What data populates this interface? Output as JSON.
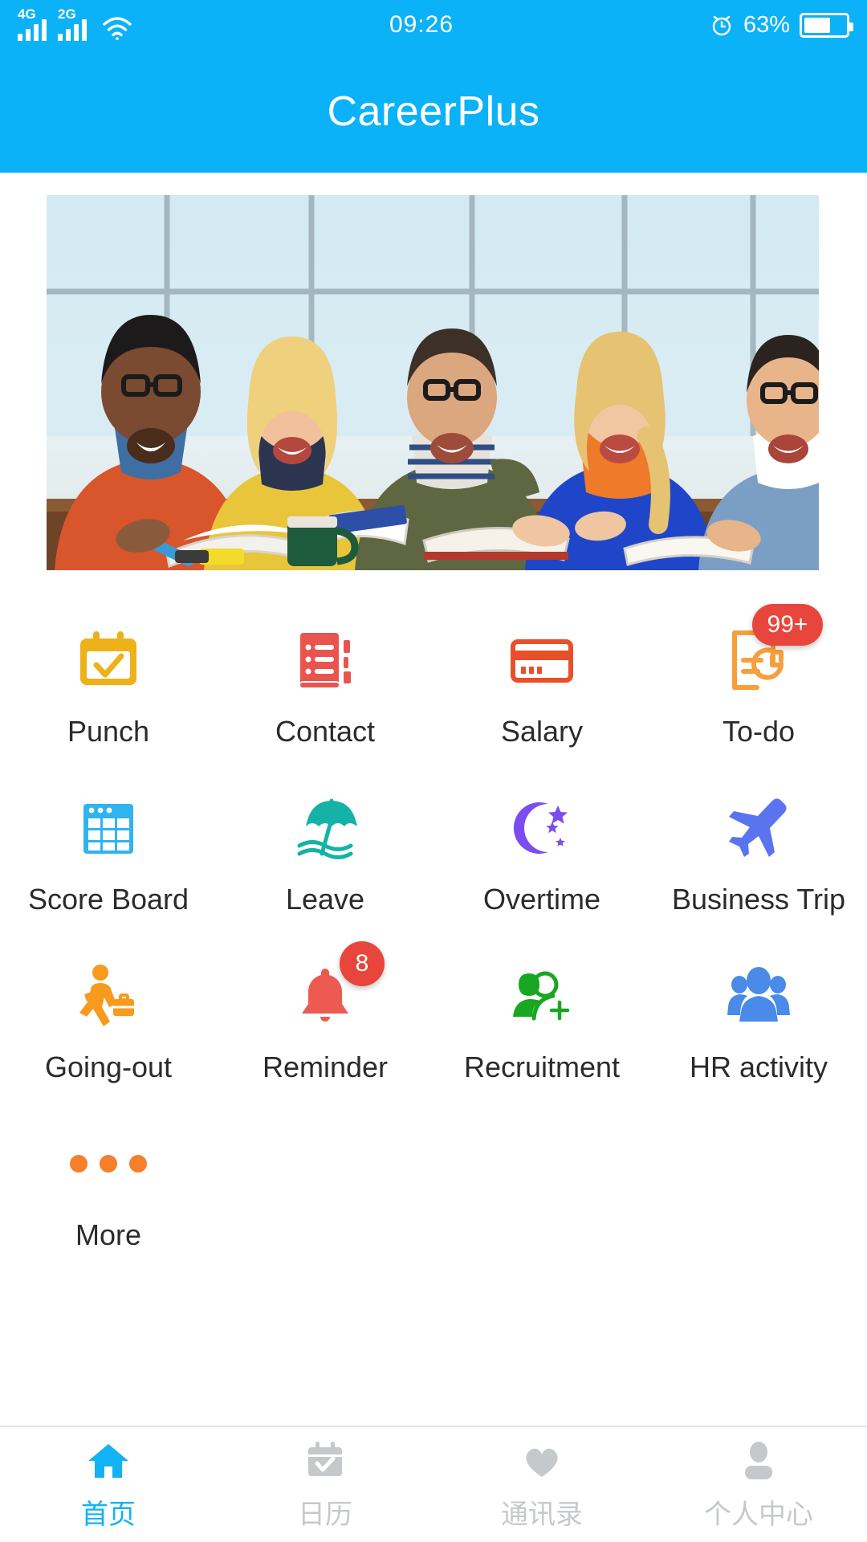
{
  "status_bar": {
    "network_primary": "4G",
    "network_secondary": "2G",
    "wifi_icon": "wifi-icon",
    "time": "09:26",
    "alarm_icon": "alarm-clock-icon",
    "battery_percent": "63%",
    "battery_level": 63
  },
  "header": {
    "title": "CareerPlus",
    "background_color": "#0bb2f7"
  },
  "banner": {
    "alt": "five smiling colleagues studying together at a table with books"
  },
  "grid": {
    "items": [
      {
        "label": "Punch",
        "icon": "calendar-check-icon",
        "color": "#edb11a",
        "badge": null
      },
      {
        "label": "Contact",
        "icon": "address-book-icon",
        "color": "#e9544f",
        "badge": null
      },
      {
        "label": "Salary",
        "icon": "credit-card-icon",
        "color": "#e8502a",
        "badge": null
      },
      {
        "label": "To-do",
        "icon": "document-clock-icon",
        "color": "#f5a03c",
        "badge": "99+"
      },
      {
        "label": "Score Board",
        "icon": "table-grid-icon",
        "color": "#2fb4f0",
        "badge": null
      },
      {
        "label": "Leave",
        "icon": "beach-umbrella-icon",
        "color": "#14b3a6",
        "badge": null
      },
      {
        "label": "Overtime",
        "icon": "moon-stars-icon",
        "color": "#7b4df0",
        "badge": null
      },
      {
        "label": "Business Trip",
        "icon": "airplane-icon",
        "color": "#5a74f0",
        "badge": null
      },
      {
        "label": "Going-out",
        "icon": "walking-briefcase-icon",
        "color": "#f79a1e",
        "badge": null
      },
      {
        "label": "Reminder",
        "icon": "bell-icon",
        "color": "#ec5a52",
        "badge": "8"
      },
      {
        "label": "Recruitment",
        "icon": "person-add-icon",
        "color": "#19a721",
        "badge": null
      },
      {
        "label": "HR activity",
        "icon": "people-group-icon",
        "color": "#4a8ae8",
        "badge": null
      },
      {
        "label": "More",
        "icon": "ellipsis-icon",
        "color": "#f57f2a",
        "badge": null
      }
    ],
    "badge_color": "#e8453c"
  },
  "tab_bar": {
    "active_color": "#12b3f4",
    "inactive_color": "#c6c9cc",
    "items": [
      {
        "label": "首页",
        "icon": "home-icon",
        "active": true
      },
      {
        "label": "日历",
        "icon": "calendar-check-icon",
        "active": false
      },
      {
        "label": "通讯录",
        "icon": "heart-icon",
        "active": false
      },
      {
        "label": "个人中心",
        "icon": "person-icon",
        "active": false
      }
    ]
  }
}
